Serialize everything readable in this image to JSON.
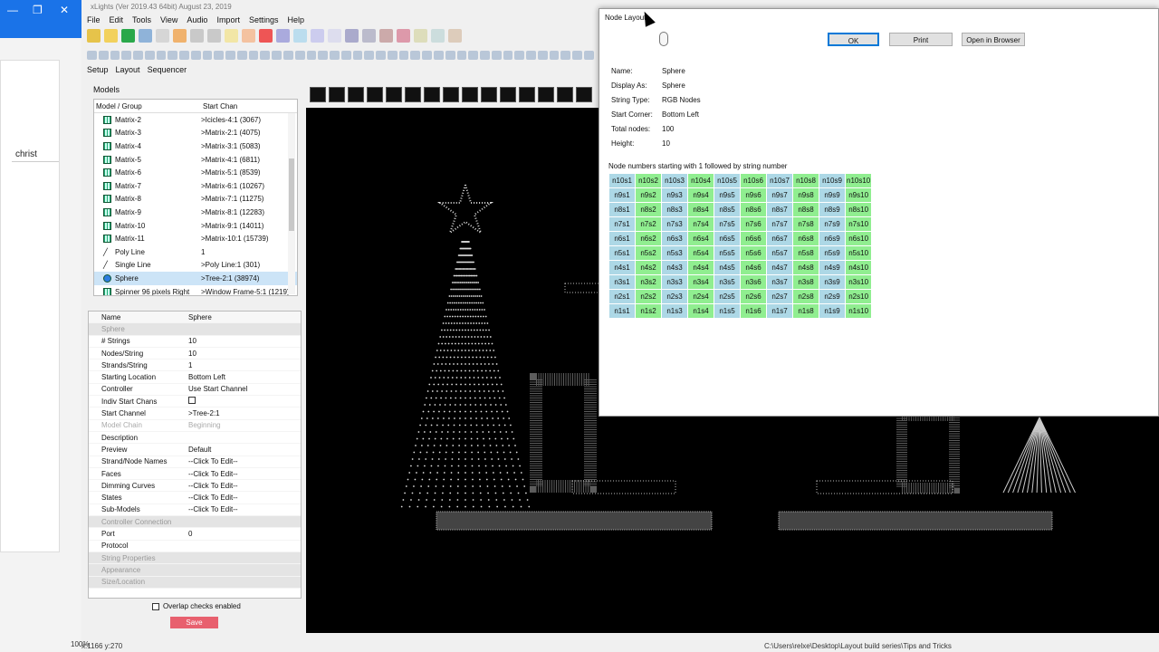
{
  "browser_strip": {
    "tab_text": "christ",
    "minimize": "—",
    "restore": "❐",
    "close": "✕"
  },
  "app": {
    "title": "xLights (Ver 2019.43 64bit) August 23, 2019",
    "menu": [
      "File",
      "Edit",
      "Tools",
      "View",
      "Audio",
      "Import",
      "Settings",
      "Help"
    ],
    "tabs": [
      "Setup",
      "Layout",
      "Sequencer"
    ],
    "models_label": "Models",
    "tree": {
      "headers": [
        "Model / Group",
        "Start Chan"
      ],
      "rows": [
        {
          "name": "Matrix-2",
          "chan": ">Icicles-4:1 (3067)"
        },
        {
          "name": "Matrix-3",
          "chan": ">Matrix-2:1 (4075)"
        },
        {
          "name": "Matrix-4",
          "chan": ">Matrix-3:1 (5083)"
        },
        {
          "name": "Matrix-5",
          "chan": ">Matrix-4:1 (6811)"
        },
        {
          "name": "Matrix-6",
          "chan": ">Matrix-5:1 (8539)"
        },
        {
          "name": "Matrix-7",
          "chan": ">Matrix-6:1 (10267)"
        },
        {
          "name": "Matrix-8",
          "chan": ">Matrix-7:1 (11275)"
        },
        {
          "name": "Matrix-9",
          "chan": ">Matrix-8:1 (12283)"
        },
        {
          "name": "Matrix-10",
          "chan": ">Matrix-9:1 (14011)"
        },
        {
          "name": "Matrix-11",
          "chan": ">Matrix-10:1 (15739)"
        },
        {
          "name": "Poly Line",
          "chan": "1"
        },
        {
          "name": "Single Line",
          "chan": ">Poly Line:1 (301)"
        },
        {
          "name": "Sphere",
          "chan": ">Tree-2:1 (38974)"
        },
        {
          "name": "Spinner 96 pixels Right",
          "chan": ">Window Frame-5:1 (1219)"
        }
      ]
    },
    "props": {
      "header": {
        "name": "Name",
        "value": "Sphere"
      },
      "rows": [
        {
          "type": "cat",
          "name": "Sphere"
        },
        {
          "name": "# Strings",
          "value": "10"
        },
        {
          "name": "Nodes/String",
          "value": "10"
        },
        {
          "name": "Strands/String",
          "value": "1"
        },
        {
          "name": "Starting Location",
          "value": "Bottom Left"
        },
        {
          "name": "Controller",
          "value": "Use Start Channel"
        },
        {
          "name": "Indiv Start Chans",
          "value": ""
        },
        {
          "name": "Start Channel",
          "value": ">Tree-2:1"
        },
        {
          "name": "Model Chain",
          "value": "Beginning",
          "dim": true
        },
        {
          "name": "Description",
          "value": ""
        },
        {
          "name": "Preview",
          "value": "Default"
        },
        {
          "name": "Strand/Node Names",
          "value": "--Click To Edit--"
        },
        {
          "name": "Faces",
          "value": "--Click To Edit--"
        },
        {
          "name": "Dimming Curves",
          "value": "--Click To Edit--"
        },
        {
          "name": "States",
          "value": "--Click To Edit--"
        },
        {
          "name": "Sub-Models",
          "value": "--Click To Edit--"
        },
        {
          "type": "cat",
          "name": "Controller Connection"
        },
        {
          "name": "Port",
          "value": "0"
        },
        {
          "name": "Protocol",
          "value": ""
        },
        {
          "type": "cat",
          "name": "String Properties"
        },
        {
          "type": "cat",
          "name": "Appearance"
        },
        {
          "type": "cat",
          "name": "Size/Location"
        }
      ]
    },
    "overlap_label": "Overlap checks enabled",
    "save_label": "Save",
    "coords": "x:1166 y:270",
    "zoom": "100%",
    "status_path": "C:\\Users\\relxe\\Desktop\\Layout build series\\Tips and Tricks"
  },
  "dialog": {
    "title": "Node Layout",
    "ok": "OK",
    "print": "Print",
    "open_browser": "Open in Browser",
    "info": [
      {
        "k": "Name:",
        "v": "Sphere"
      },
      {
        "k": "Display As:",
        "v": "Sphere"
      },
      {
        "k": "String Type:",
        "v": "RGB Nodes"
      },
      {
        "k": "Start Corner:",
        "v": "Bottom Left"
      },
      {
        "k": "Total nodes:",
        "v": "100"
      },
      {
        "k": "Height:",
        "v": "10"
      }
    ],
    "grid_caption": "Node numbers starting with 1 followed by string number",
    "strings": 10,
    "nodes_per_string": 10,
    "colors": {
      "even_col": "#add8e6",
      "odd_col": "#90ee90"
    }
  }
}
